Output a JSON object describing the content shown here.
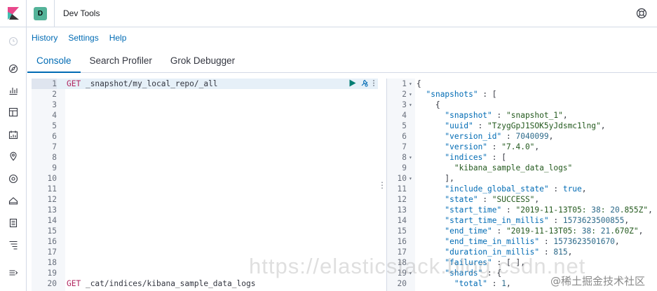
{
  "header": {
    "space_initial": "D",
    "title": "Dev Tools"
  },
  "menu": {
    "history": "History",
    "settings": "Settings",
    "help": "Help"
  },
  "tabs": [
    {
      "label": "Console",
      "active": true
    },
    {
      "label": "Search Profiler",
      "active": false
    },
    {
      "label": "Grok Debugger",
      "active": false
    }
  ],
  "request_editor": {
    "line_numbers": [
      "1",
      "2",
      "3",
      "4",
      "5",
      "6",
      "7",
      "8",
      "9",
      "10",
      "11",
      "12",
      "13",
      "14",
      "15",
      "16",
      "17",
      "18",
      "19",
      "20"
    ],
    "line1_method": "GET",
    "line1_url": " _snapshot/my_local_repo/_all",
    "line20_method": "GET",
    "line20_url": " _cat/indices/kibana_sample_data_logs"
  },
  "response_editor": {
    "lines": [
      {
        "n": "1",
        "fold": "▾",
        "text": "{"
      },
      {
        "n": "2",
        "fold": "▾",
        "text": "  \"snapshots\" : ["
      },
      {
        "n": "3",
        "fold": "▾",
        "text": "    {"
      },
      {
        "n": "4",
        "fold": "",
        "text": "      \"snapshot\" : \"snapshot_1\","
      },
      {
        "n": "5",
        "fold": "",
        "text": "      \"uuid\" : \"TzygGpJ1SOK5yJdsmc1lng\","
      },
      {
        "n": "6",
        "fold": "",
        "text": "      \"version_id\" : 7040099,"
      },
      {
        "n": "7",
        "fold": "",
        "text": "      \"version\" : \"7.4.0\","
      },
      {
        "n": "8",
        "fold": "▾",
        "text": "      \"indices\" : ["
      },
      {
        "n": "9",
        "fold": "",
        "text": "        \"kibana_sample_data_logs\""
      },
      {
        "n": "10",
        "fold": "▾",
        "text": "      ],"
      },
      {
        "n": "11",
        "fold": "",
        "text": "      \"include_global_state\" : true,"
      },
      {
        "n": "12",
        "fold": "",
        "text": "      \"state\" : \"SUCCESS\","
      },
      {
        "n": "13",
        "fold": "",
        "text": "      \"start_time\" : \"2019-11-13T05:38:20.855Z\","
      },
      {
        "n": "14",
        "fold": "",
        "text": "      \"start_time_in_millis\" : 1573623500855,"
      },
      {
        "n": "15",
        "fold": "",
        "text": "      \"end_time\" : \"2019-11-13T05:38:21.670Z\","
      },
      {
        "n": "16",
        "fold": "",
        "text": "      \"end_time_in_millis\" : 1573623501670,"
      },
      {
        "n": "17",
        "fold": "",
        "text": "      \"duration_in_millis\" : 815,"
      },
      {
        "n": "18",
        "fold": "",
        "text": "      \"failures\" : [ ],"
      },
      {
        "n": "19",
        "fold": "▾",
        "text": "      \"shards\" : {"
      },
      {
        "n": "20",
        "fold": "",
        "text": "        \"total\" : 1,"
      }
    ]
  },
  "watermark": {
    "url": "https://elasticstack.blog.csdn.net",
    "site": "@稀土掘金技术社区"
  },
  "icons": {
    "logo": "kibana-logo-icon",
    "help": "help-menu-icon",
    "run": "play-icon",
    "wrench": "wrench-icon",
    "more": "more-vertical-icon"
  },
  "colors": {
    "accent": "#006bb4",
    "space_avatar": "#54b399",
    "method": "#b0255f",
    "run_button": "#017d73"
  }
}
